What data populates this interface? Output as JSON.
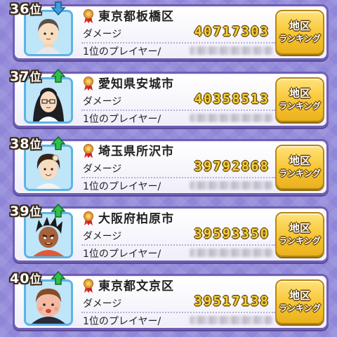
{
  "labels": {
    "damage": "ダメージ",
    "top_player": "1位のプレイヤー/",
    "rank_suffix": "位",
    "button_line1": "地区",
    "button_line2": "ランキング"
  },
  "colors": {
    "background": "#8f86d8",
    "card_border": "#6f5fb4",
    "damage_value": "#f4d23a",
    "button": "#f7c531",
    "arrow_down": "#3aa0e0",
    "arrow_up": "#2fbf4a"
  },
  "rows": [
    {
      "rank": "36",
      "trend": "down",
      "trend_icon": "arrow-down-icon",
      "region": "東京都板橋区",
      "damage": "40717303",
      "top_player_name": ""
    },
    {
      "rank": "37",
      "trend": "up",
      "trend_icon": "arrow-up-icon",
      "region": "愛知県安城市",
      "damage": "40358513",
      "top_player_name": ""
    },
    {
      "rank": "38",
      "trend": "up",
      "trend_icon": "arrow-up-icon",
      "region": "埼玉県所沢市",
      "damage": "39792868",
      "top_player_name": ""
    },
    {
      "rank": "39",
      "trend": "up",
      "trend_icon": "arrow-up-icon",
      "region": "大阪府柏原市",
      "damage": "39593350",
      "top_player_name": ""
    },
    {
      "rank": "40",
      "trend": "up",
      "trend_icon": "arrow-up-icon",
      "region": "東京都文京区",
      "damage": "39517138",
      "top_player_name": ""
    }
  ]
}
